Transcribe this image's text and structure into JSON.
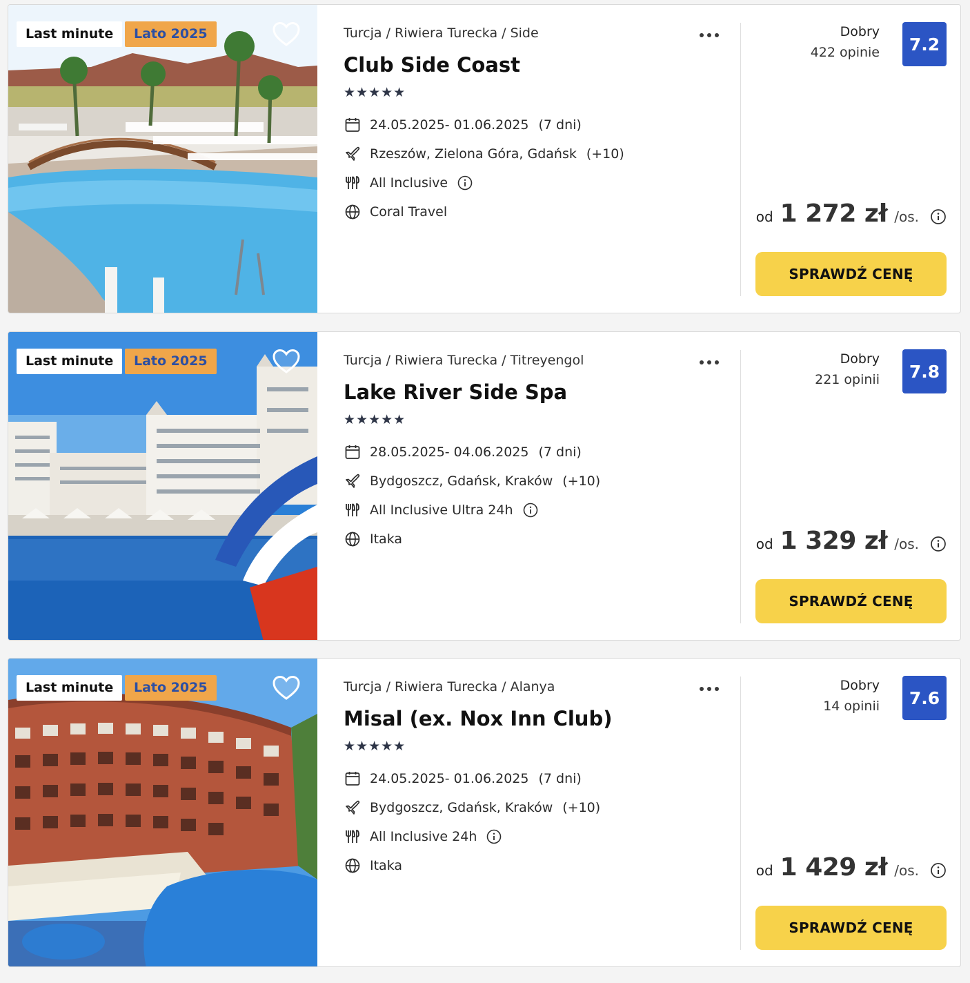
{
  "colors": {
    "score_bg": "#2b55c4",
    "cta_bg": "#f7d24a",
    "season_badge_bg": "#f0a64a",
    "season_badge_text": "#2c4fa3"
  },
  "offers": [
    {
      "badge_last_minute": "Last minute",
      "badge_season": "Lato 2025",
      "photo": "outdoor pool with wooden bridge and sun loungers",
      "breadcrumb": "Turcja / Riwiera Turecka / Side",
      "name": "Club Side Coast",
      "stars": "★★★★★",
      "dates": "24.05.2025- 01.06.2025",
      "duration": "(7 dni)",
      "departures": "Rzeszów, Zielona Góra, Gdańsk",
      "departures_more": "(+10)",
      "board": "All Inclusive",
      "operator": "Coral Travel",
      "rating_label": "Dobry",
      "reviews": "422 opinie",
      "score": "7.2",
      "price_prefix": "od",
      "price": "1 272 zł",
      "price_suffix": "/os.",
      "cta": "SPRAWDŹ CENĘ"
    },
    {
      "badge_last_minute": "Last minute",
      "badge_season": "Lato 2025",
      "photo": "white hotel buildings, pool and blue waterslide",
      "breadcrumb": "Turcja / Riwiera Turecka / Titreyengol",
      "name": "Lake River Side Spa",
      "stars": "★★★★★",
      "dates": "28.05.2025- 04.06.2025",
      "duration": "(7 dni)",
      "departures": "Bydgoszcz, Gdańsk, Kraków",
      "departures_more": "(+10)",
      "board": "All Inclusive Ultra 24h",
      "operator": "Itaka",
      "rating_label": "Dobry",
      "reviews": "221 opinii",
      "score": "7.8",
      "price_prefix": "od",
      "price": "1 329 zł",
      "price_suffix": "/os.",
      "cta": "SPRAWDŹ CENĘ"
    },
    {
      "badge_last_minute": "Last minute",
      "badge_season": "Lato 2025",
      "photo": "curved red brick hotel with pools below",
      "breadcrumb": "Turcja / Riwiera Turecka / Alanya",
      "name": "Misal (ex. Nox Inn Club)",
      "stars": "★★★★★",
      "dates": "24.05.2025- 01.06.2025",
      "duration": "(7 dni)",
      "departures": "Bydgoszcz, Gdańsk, Kraków",
      "departures_more": "(+10)",
      "board": "All Inclusive 24h",
      "operator": "Itaka",
      "rating_label": "Dobry",
      "reviews": "14 opinii",
      "score": "7.6",
      "price_prefix": "od",
      "price": "1 429 zł",
      "price_suffix": "/os.",
      "cta": "SPRAWDŹ CENĘ"
    }
  ]
}
